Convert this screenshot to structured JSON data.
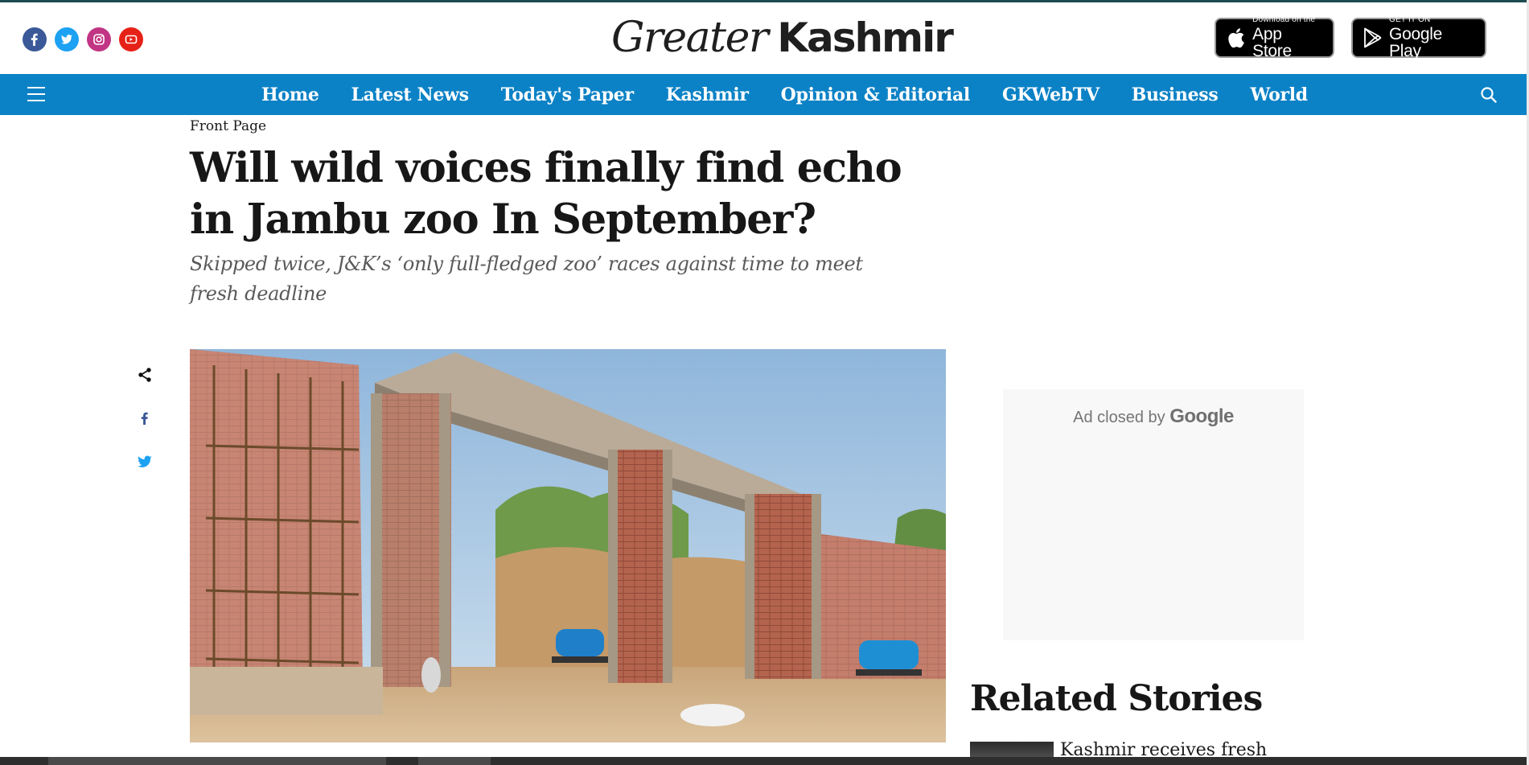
{
  "site": {
    "brand_first": "Greater",
    "brand_second": "Kashmir",
    "brand_color": "#0b82c6"
  },
  "socials": [
    {
      "name": "facebook",
      "icon": "facebook-icon",
      "color": "#3b5998"
    },
    {
      "name": "twitter",
      "icon": "twitter-icon",
      "color": "#1da1f2"
    },
    {
      "name": "instagram",
      "icon": "instagram-icon",
      "color": "#c13584"
    },
    {
      "name": "youtube",
      "icon": "youtube-icon",
      "color": "#e62117"
    }
  ],
  "stores": {
    "apple": {
      "small": "Download on the",
      "big": "App Store"
    },
    "google": {
      "small": "GET IT ON",
      "big": "Google Play"
    }
  },
  "nav": {
    "items": [
      "Home",
      "Latest News",
      "Today's Paper",
      "Kashmir",
      "Opinion & Editorial",
      "GKWebTV",
      "Business",
      "World"
    ],
    "menu_icon": "hamburger-icon",
    "search_icon": "search-icon"
  },
  "article": {
    "section": "Front Page",
    "headline": "Will wild voices finally find echo in Jambu zoo In September?",
    "subhead": "Skipped twice, J&K’s ‘only full-fledged zoo’ races against time to meet fresh deadline",
    "share_icons": [
      "share-icon",
      "facebook-icon",
      "twitter-icon"
    ]
  },
  "ad": {
    "text": "Ad closed by",
    "brand": "Google"
  },
  "related": {
    "title": "Related Stories",
    "items": [
      {
        "title": "Kashmir receives fresh"
      }
    ]
  }
}
